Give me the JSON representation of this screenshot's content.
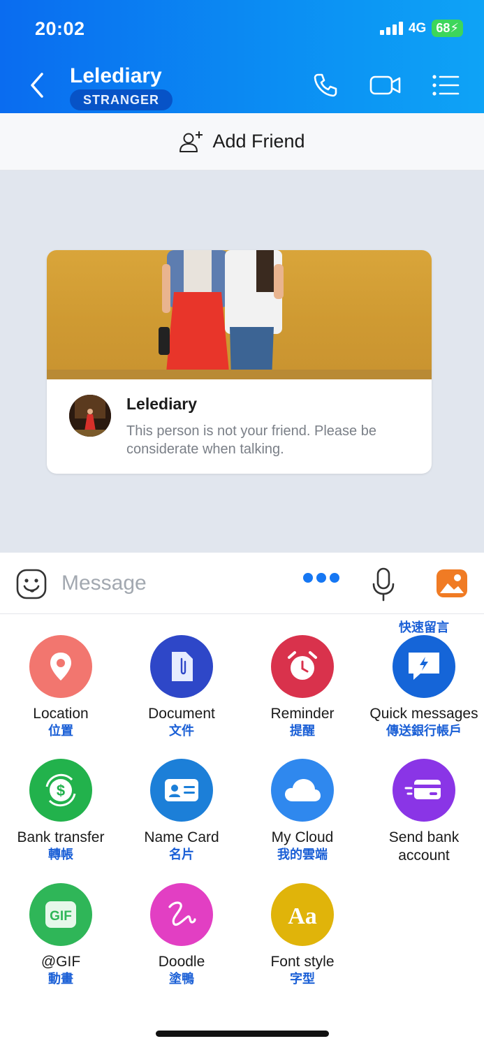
{
  "status_bar": {
    "time": "20:02",
    "network": "4G",
    "battery": "68"
  },
  "header": {
    "title": "Lelediary",
    "badge": "STRANGER",
    "icons": [
      "back-icon",
      "phone-icon",
      "video-icon",
      "list-icon"
    ]
  },
  "add_friend": {
    "label": "Add Friend",
    "icon": "add-user-icon"
  },
  "profile_card": {
    "name": "Lelediary",
    "description": "This person is not your friend. Please be considerate when talking."
  },
  "composer": {
    "placeholder": "Message",
    "icons": [
      "emoji-icon",
      "more-icon",
      "mic-icon",
      "image-icon"
    ]
  },
  "actions": [
    {
      "label": "Location",
      "sub": "位置",
      "icon": "location-icon",
      "color": "#f2766f"
    },
    {
      "label": "Document",
      "sub": "文件",
      "icon": "document-icon",
      "color": "#2e47c8"
    },
    {
      "label": "Reminder",
      "sub": "提醒",
      "icon": "alarm-icon",
      "color": "#d9324c"
    },
    {
      "label": "Quick messages",
      "sub_above": "快速留言",
      "sub": "傳送銀行帳戶",
      "icon": "quick-message-icon",
      "color": "#1565d8"
    },
    {
      "label": "Bank transfer",
      "sub": "轉帳",
      "icon": "bank-transfer-icon",
      "color": "#22b24c"
    },
    {
      "label": "Name Card",
      "sub": "名片",
      "icon": "name-card-icon",
      "color": "#1c7fd8"
    },
    {
      "label": "My Cloud",
      "sub": "我的雲端",
      "icon": "cloud-icon",
      "color": "#2f88ee"
    },
    {
      "label": "Send bank account",
      "icon": "bank-card-icon",
      "color": "#8a35e6"
    },
    {
      "label": "@GIF",
      "sub": "動畫",
      "icon": "gif-icon",
      "color": "#2fb658"
    },
    {
      "label": "Doodle",
      "sub": "塗鴨",
      "icon": "doodle-icon",
      "color": "#e23fc3"
    },
    {
      "label": "Font style",
      "sub": "字型",
      "icon": "font-style-icon",
      "color": "#e0b40a"
    }
  ]
}
